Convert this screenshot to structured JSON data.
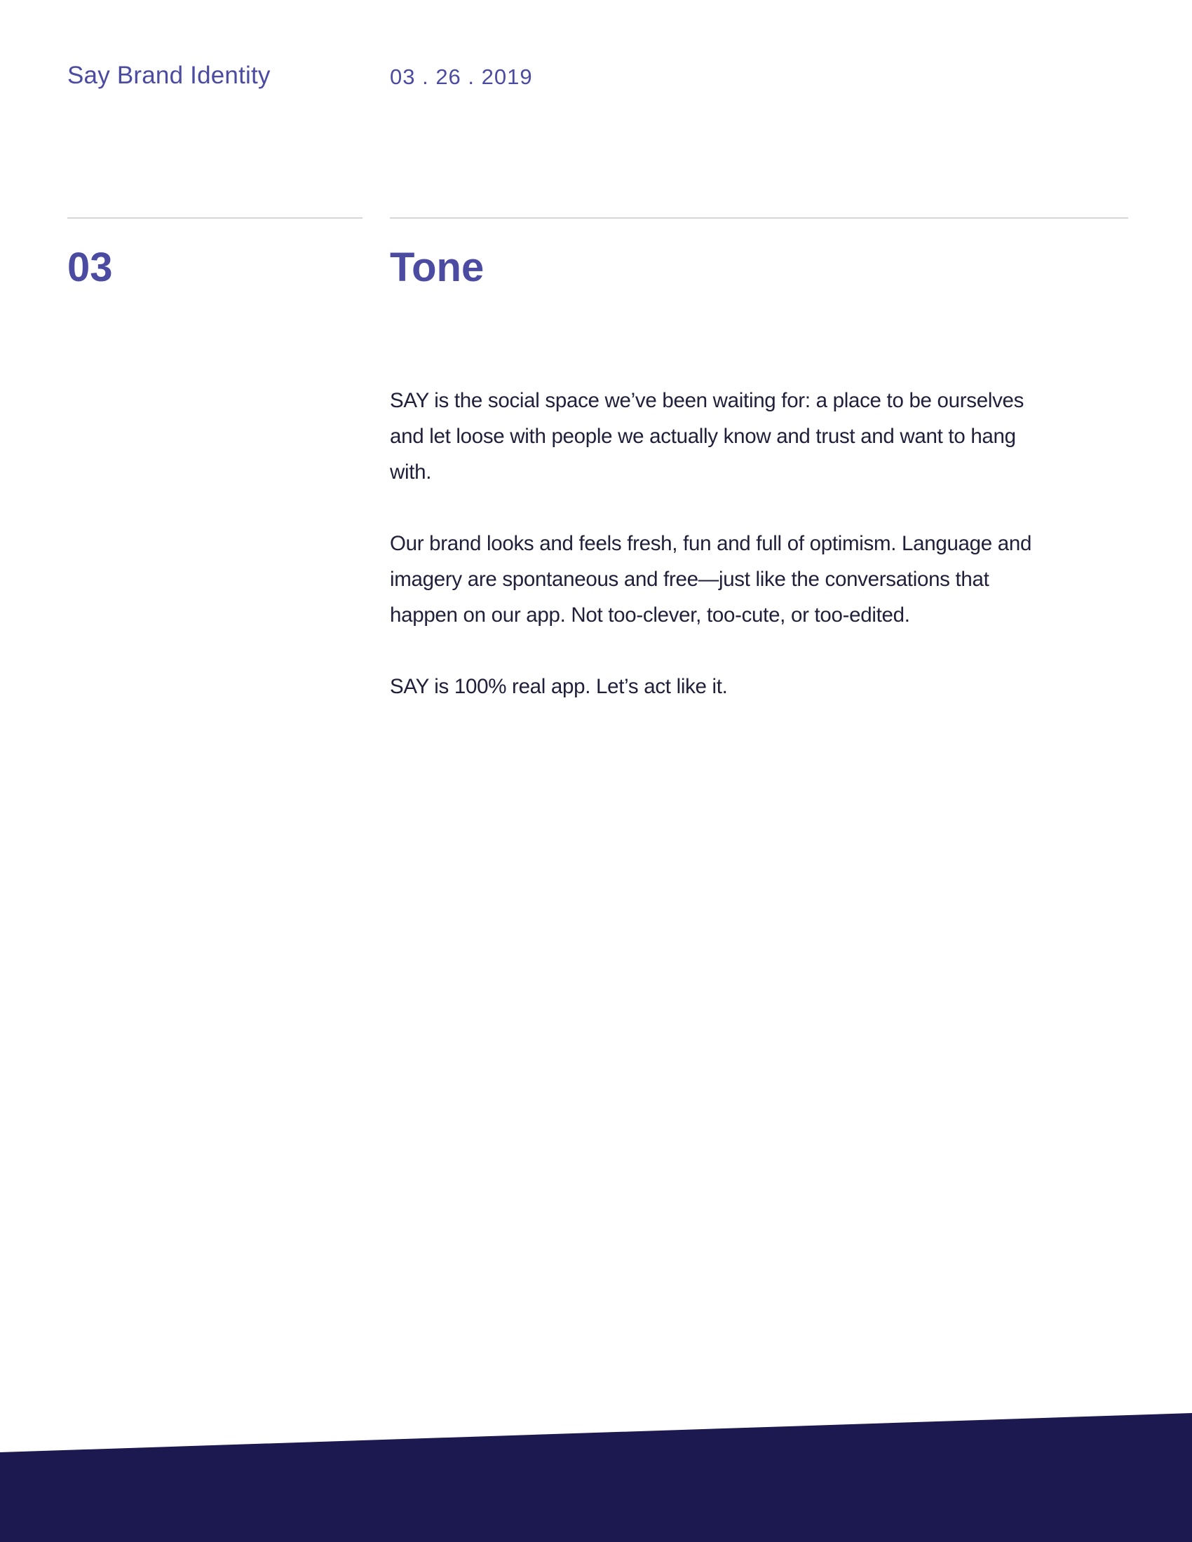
{
  "header": {
    "brand": "Say Brand Identity",
    "date": "03 . 26 . 2019"
  },
  "section": {
    "number": "03",
    "title": "Tone"
  },
  "body": {
    "paragraphs": [
      "SAY is the social space we’ve been waiting for: a place to be ourselves and let loose with people we actually know and trust and want to hang with.",
      "Our brand looks and feels fresh, fun and full of optimism. Language and imagery are spontaneous and free—just like the conversations that happen on our app. Not too-clever, too-cute, or too-edited.",
      "SAY is 100% real app. Let’s act like it."
    ]
  },
  "colors": {
    "accent": "#4b4ba1",
    "text": "#20203a",
    "footer": "#1c1850",
    "rule": "#d5d5dc"
  }
}
